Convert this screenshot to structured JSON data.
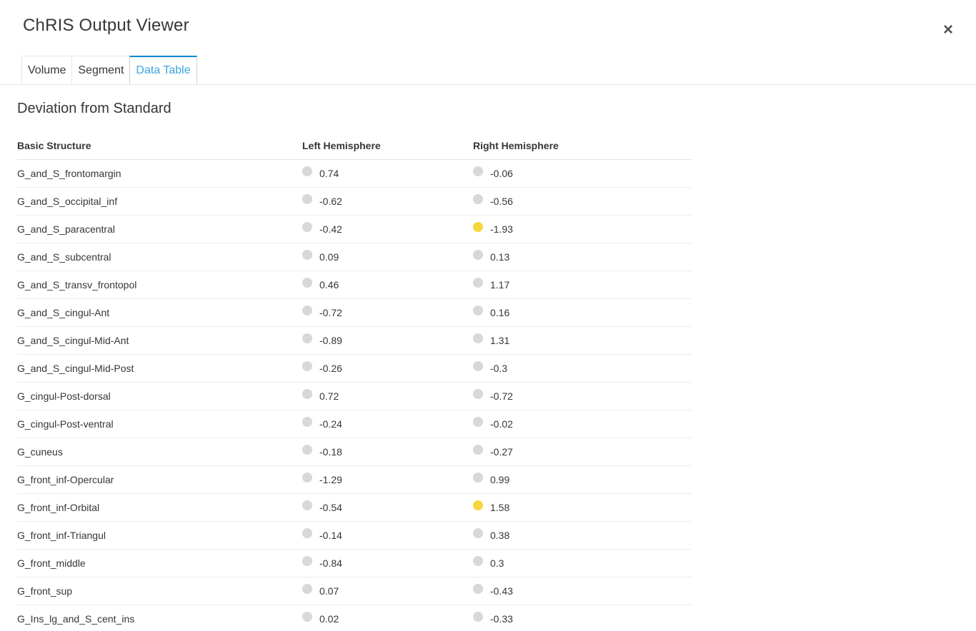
{
  "header": {
    "title": "ChRIS Output Viewer",
    "close_label": "×"
  },
  "tabs": [
    {
      "label": "Volume",
      "active": false
    },
    {
      "label": "Segment",
      "active": false
    },
    {
      "label": "Data Table",
      "active": true
    }
  ],
  "section_title": "Deviation from Standard",
  "table": {
    "columns": [
      "Basic Structure",
      "Left Hemisphere",
      "Right Hemisphere"
    ],
    "rows": [
      {
        "structure": "G_and_S_frontomargin",
        "left": "0.74",
        "left_status": "normal",
        "right": "-0.06",
        "right_status": "normal"
      },
      {
        "structure": "G_and_S_occipital_inf",
        "left": "-0.62",
        "left_status": "normal",
        "right": "-0.56",
        "right_status": "normal"
      },
      {
        "structure": "G_and_S_paracentral",
        "left": "-0.42",
        "left_status": "normal",
        "right": "-1.93",
        "right_status": "warning"
      },
      {
        "structure": "G_and_S_subcentral",
        "left": "0.09",
        "left_status": "normal",
        "right": "0.13",
        "right_status": "normal"
      },
      {
        "structure": "G_and_S_transv_frontopol",
        "left": "0.46",
        "left_status": "normal",
        "right": "1.17",
        "right_status": "normal"
      },
      {
        "structure": "G_and_S_cingul-Ant",
        "left": "-0.72",
        "left_status": "normal",
        "right": "0.16",
        "right_status": "normal"
      },
      {
        "structure": "G_and_S_cingul-Mid-Ant",
        "left": "-0.89",
        "left_status": "normal",
        "right": "1.31",
        "right_status": "normal"
      },
      {
        "structure": "G_and_S_cingul-Mid-Post",
        "left": "-0.26",
        "left_status": "normal",
        "right": "-0.3",
        "right_status": "normal"
      },
      {
        "structure": "G_cingul-Post-dorsal",
        "left": "0.72",
        "left_status": "normal",
        "right": "-0.72",
        "right_status": "normal"
      },
      {
        "structure": "G_cingul-Post-ventral",
        "left": "-0.24",
        "left_status": "normal",
        "right": "-0.02",
        "right_status": "normal"
      },
      {
        "structure": "G_cuneus",
        "left": "-0.18",
        "left_status": "normal",
        "right": "-0.27",
        "right_status": "normal"
      },
      {
        "structure": "G_front_inf-Opercular",
        "left": "-1.29",
        "left_status": "normal",
        "right": "0.99",
        "right_status": "normal"
      },
      {
        "structure": "G_front_inf-Orbital",
        "left": "-0.54",
        "left_status": "normal",
        "right": "1.58",
        "right_status": "warning"
      },
      {
        "structure": "G_front_inf-Triangul",
        "left": "-0.14",
        "left_status": "normal",
        "right": "0.38",
        "right_status": "normal"
      },
      {
        "structure": "G_front_middle",
        "left": "-0.84",
        "left_status": "normal",
        "right": "0.3",
        "right_status": "normal"
      },
      {
        "structure": "G_front_sup",
        "left": "0.07",
        "left_status": "normal",
        "right": "-0.43",
        "right_status": "normal"
      },
      {
        "structure": "G_Ins_lg_and_S_cent_ins",
        "left": "0.02",
        "left_status": "normal",
        "right": "-0.33",
        "right_status": "normal"
      }
    ]
  },
  "colors": {
    "accent": "#39a5dc",
    "status_normal": "#d8d8d8",
    "status_warning": "#f5d63d"
  }
}
